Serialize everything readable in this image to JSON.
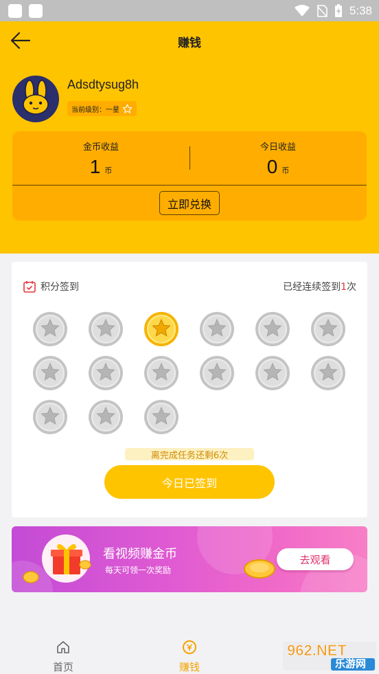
{
  "status_bar": {
    "time": "5:38"
  },
  "header": {
    "title": "赚钱"
  },
  "profile": {
    "username": "Adsdtysug8h",
    "level_label": "当前级别：一星"
  },
  "earnings": {
    "coin_label": "金币收益",
    "coin_value": "1",
    "coin_unit": "币",
    "today_label": "今日收益",
    "today_value": "0",
    "today_unit": "币",
    "redeem_label": "立即兑换"
  },
  "signin": {
    "title": "积分签到",
    "streak_prefix": "已经连续签到",
    "streak_count": "1",
    "streak_suffix": "次",
    "days_total": 15,
    "days_signed": [
      2
    ],
    "remaining_text": "离完成任务还剩6次",
    "button_label": "今日已签到"
  },
  "banner": {
    "title": "看视频赚金币",
    "subtitle": "每天可领一次奖励",
    "button_label": "去观看"
  },
  "tabs": [
    {
      "label": "首页",
      "icon": "home-icon",
      "active": false
    },
    {
      "label": "赚钱",
      "icon": "coin-icon",
      "active": true
    }
  ],
  "watermark": {
    "text": "乐游网",
    "logo_text": "962.NET"
  },
  "colors": {
    "brand_yellow": "#ffc400",
    "card_orange": "#ffad00",
    "accent_red": "#e5343c",
    "tab_active": "#f5a300",
    "tab_inactive": "#666666"
  }
}
